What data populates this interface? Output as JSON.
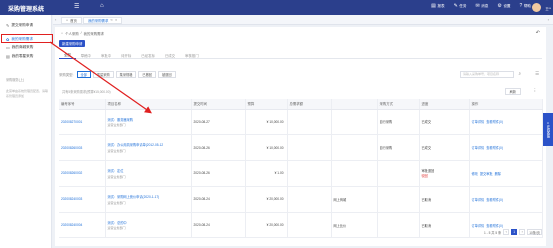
{
  "app": {
    "brand": "采购管理系统",
    "top_actions": [
      {
        "icon": "chart-icon",
        "glyph": "▤",
        "label": "报表"
      },
      {
        "icon": "tasks-icon",
        "glyph": "✎",
        "label": "任务"
      },
      {
        "icon": "message-icon",
        "glyph": "✉",
        "label": "消息"
      },
      {
        "icon": "settings-icon",
        "glyph": "⚙",
        "label": "设置"
      },
      {
        "icon": "help-icon",
        "glyph": "?",
        "label": "帮助"
      }
    ],
    "user_name": "王**"
  },
  "sidebar": {
    "items": [
      {
        "label": "提交采购申请",
        "icon": "✎"
      },
      {
        "label": "我的采购需求",
        "icon": "✿"
      },
      {
        "label": "我的商城采购",
        "icon": "▭"
      },
      {
        "label": "我的零星采购",
        "icon": "▤"
      }
    ],
    "section": "采购服务(上)",
    "note": "此菜单由系统管理员配置，请联系管理员添加"
  },
  "tabs": [
    {
      "label": "首页",
      "active": false,
      "closable": false
    },
    {
      "label": "我的采购需求",
      "active": true,
      "closable": true
    }
  ],
  "breadcrumb": [
    "个人采购",
    "我的采购需求"
  ],
  "primary_button": "新建采购申请",
  "status_tabs": [
    "全部",
    "草稿中",
    "审批中",
    "待开标",
    "已经发标",
    "已成交",
    "审核推门"
  ],
  "status_tab_active": 0,
  "filter": {
    "label": "采购类型:",
    "chips": [
      "全部",
      "零星采购",
      "集采规格",
      "已撤回",
      "被退回"
    ],
    "active": 0
  },
  "search": {
    "placeholder": "请输入采购单号、项目名称"
  },
  "summary": "共有5条采购需求(预算¥15,000.00)",
  "refresh_label": "刷新",
  "table": {
    "headers": [
      "编号序号",
      "项目名称",
      "提交时间",
      "预算",
      "总需求额",
      "",
      "采购方式",
      "进度",
      "操作"
    ],
    "rows": [
      {
        "id": "202008270001",
        "name": "测试：服务器采购",
        "sub": "运营业务部门",
        "time": "2020-08-27",
        "budget": "¥ 10,000.00",
        "total": "",
        "misc": "",
        "method": "自行采购",
        "status": "已成交",
        "status_sub": "",
        "ops": [
          "订单详情",
          "查看附件(0)"
        ]
      },
      {
        "id": "202008260003",
        "name": "测试：办公用具采购申请单(2012-05-12",
        "sub": "运营业务部门",
        "time": "2020-08-26",
        "budget": "¥ 10,000.00",
        "total": "",
        "misc": "",
        "method": "自行采购",
        "status": "已成交",
        "status_sub": "",
        "ops": [
          "订单详情",
          "查看附件(0)"
        ]
      },
      {
        "id": "202008260002",
        "name": "测试：定位",
        "sub": "运营业务部门",
        "time": "2020-08-26",
        "budget": "¥ 1.00",
        "total": "",
        "misc": "",
        "method": "",
        "status": "审批退回",
        "status_sub": "驳回",
        "ops": [
          "修改",
          "提交审批",
          "删除"
        ]
      },
      {
        "id": "202008240003",
        "name": "测试：采购网上竞价申请(2020-1-17)",
        "sub": "运营业务部门",
        "time": "2020-08-24",
        "budget": "¥ 20,000.00",
        "total": "",
        "misc": "网上商城",
        "method": "",
        "status": "已取消",
        "status_sub": "",
        "ops": [
          "订单详情",
          "查看附件(0)"
        ]
      },
      {
        "id": "202008240004",
        "name": "测试：总的中",
        "sub": "运营业务部门",
        "time": "2020-08-24",
        "budget": "¥ 20,000.00",
        "total": "",
        "misc": "网上比价",
        "method": "",
        "status": "已取消",
        "status_sub": "",
        "ops": [
          "订单详情",
          "查看附件(0)"
        ]
      }
    ]
  },
  "pagination": {
    "summary": "1 - 5 共 5 条",
    "pages": [
      "1"
    ],
    "current": "1",
    "page_size": "10条/页"
  },
  "float_service": "在线客服",
  "colors": {
    "header": "#2b3f8c",
    "primary": "#2b52c8",
    "link": "#1e6fd8",
    "annotation": "#e02020"
  }
}
